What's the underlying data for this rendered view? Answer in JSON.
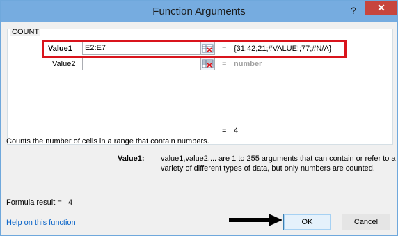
{
  "dialog": {
    "title": "Function Arguments",
    "help_glyph": "?",
    "close_glyph": "✕"
  },
  "function": {
    "name": "COUNT",
    "arguments": [
      {
        "label": "Value1",
        "value": "E2:E7",
        "result": "{31;42;21;#VALUE!;77;#N/A}"
      },
      {
        "label": "Value2",
        "value": "",
        "result": "number"
      }
    ],
    "result_line": "4",
    "description": "Counts the number of cells in a range that contain numbers.",
    "arg_help_label": "Value1:",
    "arg_help_text_line1": "value1,value2,... are 1 to 255 arguments that can contain or refer to a",
    "arg_help_text_line2": "variety of different types of data, but only numbers are counted."
  },
  "formula_result": {
    "label": "Formula result =",
    "value": "4"
  },
  "help_link": "Help on this function",
  "buttons": {
    "ok": "OK",
    "cancel": "Cancel"
  },
  "eq_sign": "=",
  "colors": {
    "title_bar": "#76ace0",
    "close": "#c7453d",
    "highlight": "#d9141c",
    "arrow": "#000000"
  }
}
